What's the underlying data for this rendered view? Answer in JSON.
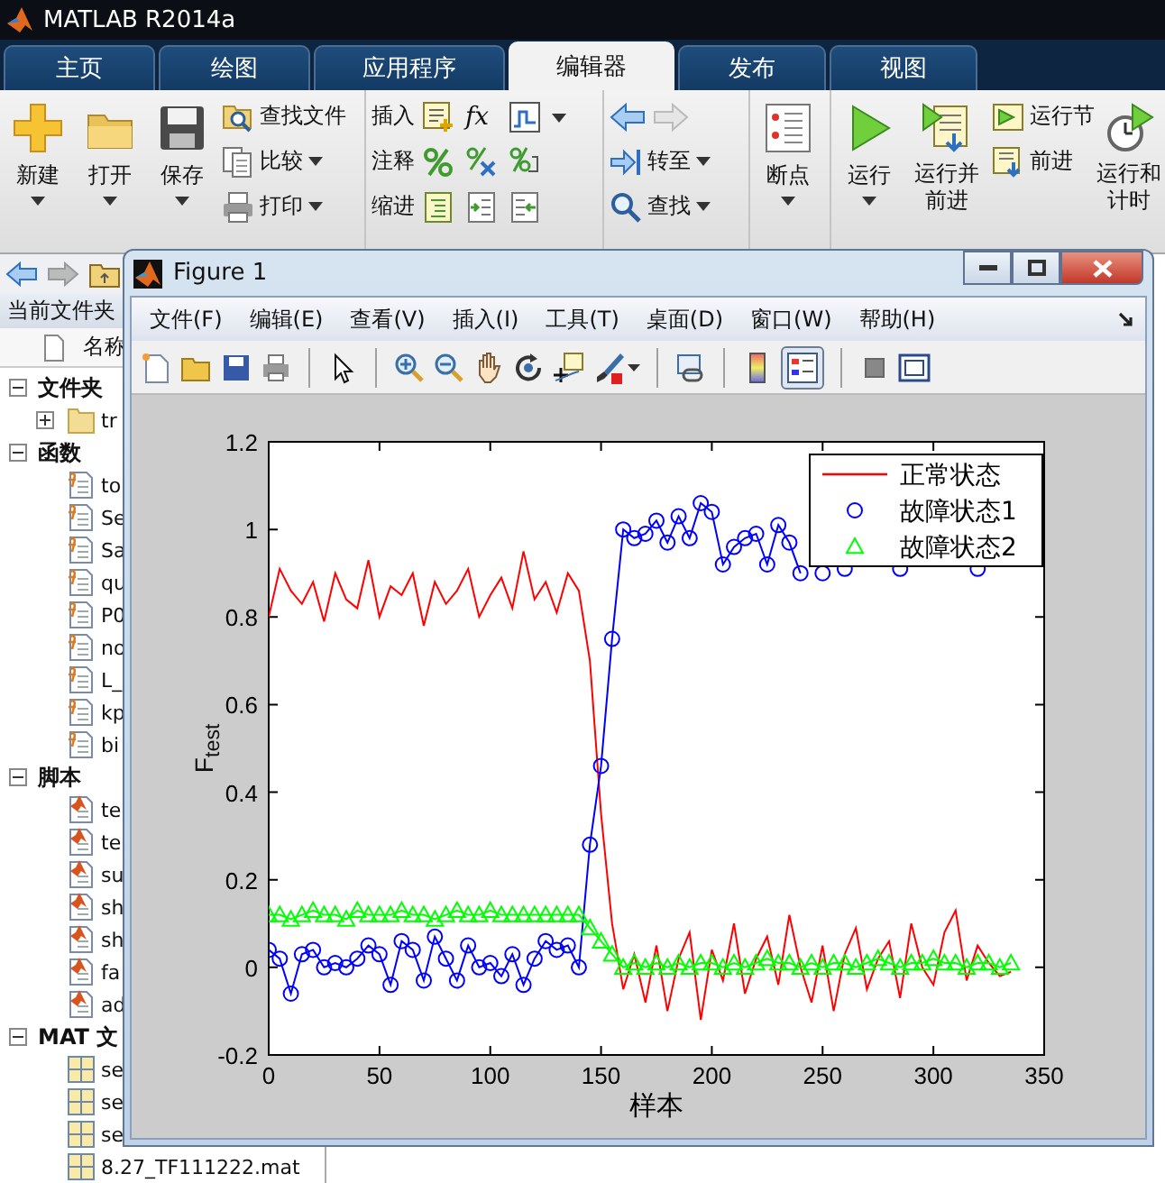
{
  "window": {
    "title": "MATLAB R2014a"
  },
  "tabs": [
    {
      "label": "主页",
      "selected": false
    },
    {
      "label": "绘图",
      "selected": false
    },
    {
      "label": "应用程序",
      "selected": false
    },
    {
      "label": "编辑器",
      "selected": true
    },
    {
      "label": "发布",
      "selected": false
    },
    {
      "label": "视图",
      "selected": false
    }
  ],
  "ribbon": {
    "new": "新建",
    "open": "打开",
    "save": "保存",
    "find_files": "查找文件",
    "compare": "比较",
    "print": "打印",
    "insert": "插入",
    "insert_function": "fx",
    "comment": "注释",
    "indent": "缩进",
    "go_to": "转至",
    "find": "查找",
    "breakpoints": "断点",
    "run": "运行",
    "run_and_advance": "运行并前进",
    "run_section": "运行节",
    "advance": "前进",
    "run_and_time": "运行和计时"
  },
  "current_folder": {
    "title": "当前文件夹",
    "column": "名称",
    "groups": [
      {
        "label": "文件夹",
        "kind": "folder",
        "expanded": true,
        "items": [
          {
            "name": "tr",
            "expanded": false
          }
        ]
      },
      {
        "label": "函数",
        "kind": "function",
        "expanded": true,
        "items": [
          {
            "name": "to"
          },
          {
            "name": "Se"
          },
          {
            "name": "Sa"
          },
          {
            "name": "qu"
          },
          {
            "name": "P0"
          },
          {
            "name": "no"
          },
          {
            "name": "L_"
          },
          {
            "name": "kp"
          },
          {
            "name": "bi"
          }
        ]
      },
      {
        "label": "脚本",
        "kind": "script",
        "expanded": true,
        "items": [
          {
            "name": "te"
          },
          {
            "name": "te"
          },
          {
            "name": "su"
          },
          {
            "name": "sh"
          },
          {
            "name": "sh"
          },
          {
            "name": "fa"
          },
          {
            "name": "ad"
          }
        ]
      },
      {
        "label": "MAT 文",
        "kind": "mat",
        "expanded": true,
        "items": [
          {
            "name": "se"
          },
          {
            "name": "se"
          },
          {
            "name": "se"
          },
          {
            "name": "8.27_TF111222.mat"
          }
        ]
      }
    ]
  },
  "figure": {
    "title": "Figure 1",
    "menu": [
      "文件(F)",
      "编辑(E)",
      "查看(V)",
      "插入(I)",
      "工具(T)",
      "桌面(D)",
      "窗口(W)",
      "帮助(H)"
    ],
    "legend_button": {
      "selected": true
    },
    "chart_data": {
      "type": "line",
      "legend": "upper right",
      "xlabel": "样本",
      "ylabel": "F$_{test}$",
      "xlim": [
        0,
        350
      ],
      "ylim": [
        -0.2,
        1.2
      ],
      "xticks": [
        0,
        50,
        100,
        150,
        200,
        250,
        300,
        350
      ],
      "yticks": [
        -0.2,
        0,
        0.2,
        0.4,
        0.6,
        0.8,
        1,
        1.2
      ],
      "x": [
        0,
        5,
        10,
        15,
        20,
        25,
        30,
        35,
        40,
        45,
        50,
        55,
        60,
        65,
        70,
        75,
        80,
        85,
        90,
        95,
        100,
        105,
        110,
        115,
        120,
        125,
        130,
        135,
        140,
        145,
        150,
        155,
        160,
        165,
        170,
        175,
        180,
        185,
        190,
        195,
        200,
        205,
        210,
        215,
        220,
        225,
        230,
        235,
        240,
        245,
        250,
        255,
        260,
        265,
        270,
        275,
        280,
        285,
        290,
        295,
        300,
        305,
        310,
        315,
        320,
        325,
        330,
        335
      ],
      "series": [
        {
          "name": "正常状态",
          "color": "#ff0000",
          "marker": "none",
          "values": [
            0.8,
            0.91,
            0.86,
            0.83,
            0.88,
            0.79,
            0.9,
            0.84,
            0.82,
            0.93,
            0.8,
            0.87,
            0.85,
            0.9,
            0.78,
            0.88,
            0.83,
            0.86,
            0.91,
            0.8,
            0.85,
            0.89,
            0.82,
            0.95,
            0.84,
            0.88,
            0.81,
            0.9,
            0.86,
            0.7,
            0.35,
            0.1,
            -0.05,
            0.03,
            -0.08,
            0.05,
            -0.1,
            0.02,
            0.08,
            -0.12,
            0.04,
            -0.03,
            0.1,
            -0.06,
            0.02,
            0.07,
            -0.04,
            0.12,
            0.0,
            -0.08,
            0.05,
            -0.1,
            0.03,
            0.09,
            -0.05,
            0.02,
            0.06,
            -0.07,
            0.1,
            0.0,
            -0.04,
            0.08,
            0.13,
            -0.03,
            0.05,
            0.01,
            -0.02,
            -0.01
          ]
        },
        {
          "name": "故障状态1",
          "color": "#0000ff",
          "marker": "circle",
          "values": [
            0.04,
            0.02,
            -0.06,
            0.03,
            0.04,
            0.0,
            0.01,
            0.0,
            0.02,
            0.05,
            0.03,
            -0.04,
            0.06,
            0.04,
            -0.03,
            0.07,
            0.02,
            -0.03,
            0.05,
            0.0,
            0.01,
            -0.02,
            0.03,
            -0.04,
            0.02,
            0.06,
            0.04,
            0.05,
            0.0,
            0.28,
            0.46,
            0.75,
            1.0,
            0.98,
            0.99,
            1.02,
            0.97,
            1.03,
            0.98,
            1.06,
            1.04,
            0.92,
            0.96,
            0.98,
            0.99,
            0.92,
            1.01,
            0.97,
            0.9,
            null,
            0.9,
            null,
            0.91,
            null,
            null,
            null,
            null,
            0.91,
            null,
            null,
            null,
            null,
            null,
            null,
            0.91,
            null,
            null,
            null
          ]
        },
        {
          "name": "故障状态2",
          "color": "#00ff00",
          "marker": "triangle",
          "values": [
            0.12,
            0.12,
            0.11,
            0.12,
            0.13,
            0.12,
            0.12,
            0.11,
            0.13,
            0.12,
            0.12,
            0.12,
            0.13,
            0.12,
            0.12,
            0.11,
            0.12,
            0.13,
            0.12,
            0.12,
            0.13,
            0.12,
            0.12,
            0.12,
            0.12,
            0.12,
            0.12,
            0.12,
            0.12,
            0.09,
            0.06,
            0.03,
            0.0,
            0.01,
            0.0,
            0.01,
            0.0,
            0.01,
            0.0,
            0.01,
            0.01,
            0.0,
            0.01,
            0.0,
            0.01,
            0.02,
            0.01,
            0.01,
            0.0,
            0.01,
            0.0,
            0.01,
            0.01,
            0.0,
            0.01,
            0.02,
            0.01,
            0.0,
            0.01,
            0.01,
            0.02,
            0.01,
            0.01,
            0.0,
            0.01,
            0.01,
            0.0,
            0.01
          ]
        }
      ]
    }
  }
}
